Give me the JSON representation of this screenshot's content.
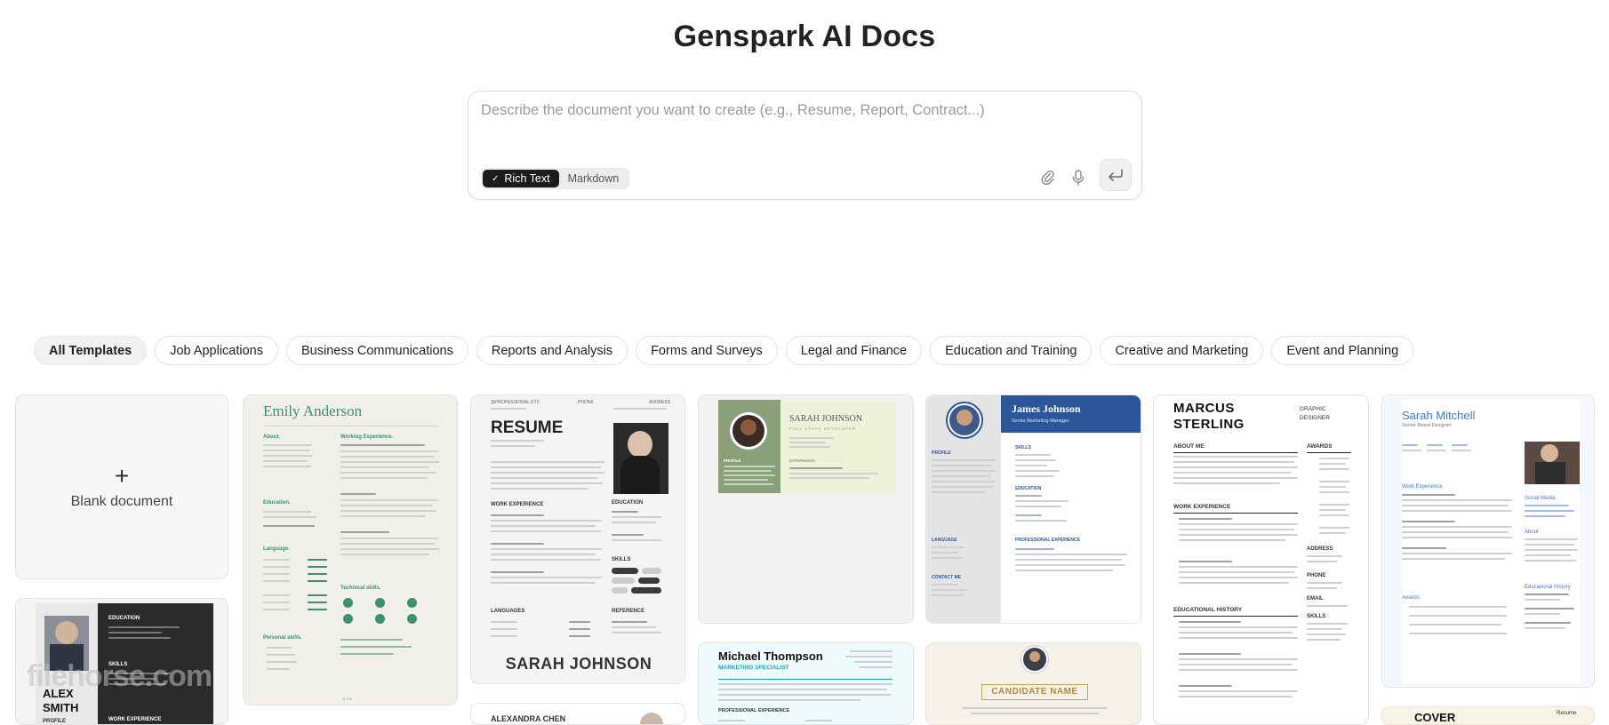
{
  "app": {
    "title": "Genspark AI Docs"
  },
  "composer": {
    "placeholder": "Describe the document you want to create (e.g., Resume, Report, Contract...)",
    "modes": [
      {
        "label": "Rich Text",
        "active": true,
        "icon": "check-icon"
      },
      {
        "label": "Markdown",
        "active": false
      }
    ],
    "icons": [
      "paperclip-icon",
      "microphone-icon",
      "send-enter-icon"
    ]
  },
  "categories": [
    {
      "label": "All Templates",
      "active": true
    },
    {
      "label": "Job Applications",
      "active": false
    },
    {
      "label": "Business Communications",
      "active": false
    },
    {
      "label": "Reports and Analysis",
      "active": false
    },
    {
      "label": "Forms and Surveys",
      "active": false
    },
    {
      "label": "Legal and Finance",
      "active": false
    },
    {
      "label": "Education and Training",
      "active": false
    },
    {
      "label": "Creative and Marketing",
      "active": false
    },
    {
      "label": "Event and Planning",
      "active": false
    }
  ],
  "templates": {
    "blank": {
      "plus": "+",
      "label": "Blank document"
    },
    "emily": {
      "name": "Emily Anderson",
      "about": "About.",
      "exp": "Working Experience.",
      "edu": "Education.",
      "lang": "Language.",
      "tech": "Technical skills.",
      "personal": "Personal skills.",
      "accent": "#3d8f6f",
      "pager": "• • •"
    },
    "resume": {
      "heading": "RESUME",
      "name": "SARAH JOHNSON",
      "work": "WORK EXPERIENCE",
      "education": "EDUCATION",
      "skills": "SKILLS",
      "languages": "LANGUAGES",
      "reference": "REFERENCE",
      "top_left": "@PROFESSIONAL ETC",
      "top_mid": "PHONE",
      "top_right": "ADDRESS"
    },
    "sarah_green": {
      "name": "SARAH JOHNSON",
      "subtitle": "FULL STACK DEVELOPER",
      "profile": "PROFILE",
      "experience": "EXPERIENCE",
      "accent": "#8aa07a",
      "bg": "#eef2d9"
    },
    "james": {
      "name": "James Johnson",
      "role": "Senior Marketing Manager",
      "skills": "SKILLS",
      "education": "EDUCATION",
      "profile": "PROFILE",
      "language": "LANGUAGE",
      "contact": "CONTACT ME",
      "pro": "PROFESSIONAL EXPERIENCE",
      "accent": "#2b579a"
    },
    "marcus": {
      "name_first": "MARCUS",
      "name_last": "STERLING",
      "role1": "GRAPHIC",
      "role2": "DESIGNER",
      "about": "ABOUT ME",
      "awards": "AWARDS",
      "work": "WORK EXPERIENCE",
      "edu": "EDUCATIONAL HISTORY",
      "phone": "PHONE",
      "address": "ADDRESS",
      "email": "EMAIL",
      "skills": "SKILLS"
    },
    "mitchell": {
      "name": "Sarah Mitchell",
      "role": "Senior Brand Designer",
      "work": "Work Experience",
      "awards": "Awards",
      "social": "Social Media",
      "about": "About",
      "edu": "Educational History",
      "accent": "#3a7bd5"
    },
    "alex": {
      "first": "ALEX",
      "last": "SMITH",
      "profile": "PROFILE",
      "education": "EDUCATION",
      "skills": "SKILLS",
      "work": "WORK EXPERIENCE"
    },
    "michael": {
      "name": "Michael Thompson",
      "role": "MARKETING SPECIALIST",
      "section": "PROFESSIONAL EXPERIENCE",
      "accent": "#1aa6b7"
    },
    "candidate": {
      "label": "CANDIDATE NAME",
      "accent": "#c8a45a"
    },
    "alexandra": {
      "name": "ALEXANDRA CHEN"
    },
    "cover": {
      "label": "COVER",
      "sub": "Resume"
    }
  },
  "watermark": "filehorse.com"
}
